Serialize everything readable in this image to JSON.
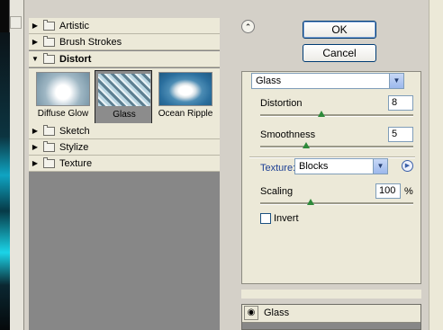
{
  "buttons": {
    "ok": "OK",
    "cancel": "Cancel"
  },
  "filter_tree": {
    "categories": [
      {
        "label": "Artistic",
        "expanded": false
      },
      {
        "label": "Brush Strokes",
        "expanded": false
      },
      {
        "label": "Distort",
        "expanded": true
      },
      {
        "label": "Sketch",
        "expanded": false
      },
      {
        "label": "Stylize",
        "expanded": false
      },
      {
        "label": "Texture",
        "expanded": false
      }
    ],
    "distort_thumbnails": [
      {
        "label": "Diffuse Glow",
        "selected": false
      },
      {
        "label": "Glass",
        "selected": true
      },
      {
        "label": "Ocean Ripple",
        "selected": false
      }
    ]
  },
  "options": {
    "filter_select": "Glass",
    "distortion": {
      "label": "Distortion",
      "value": "8",
      "slider_fraction": 0.4
    },
    "smoothness": {
      "label": "Smoothness",
      "value": "5",
      "slider_fraction": 0.3
    },
    "texture": {
      "label": "Texture:",
      "value": "Blocks"
    },
    "scaling": {
      "label": "Scaling",
      "value": "100",
      "unit": "%",
      "slider_fraction": 0.33
    },
    "invert": {
      "label": "Invert",
      "checked": false
    }
  },
  "layers": {
    "items": [
      {
        "name": "Glass"
      }
    ]
  },
  "colors": {
    "panel_bg": "#ece9d8",
    "gallery_bg": "#878787",
    "slider_thumb": "#2d8a3a",
    "button_border": "#003c74",
    "link_blue": "#1c3f94"
  }
}
